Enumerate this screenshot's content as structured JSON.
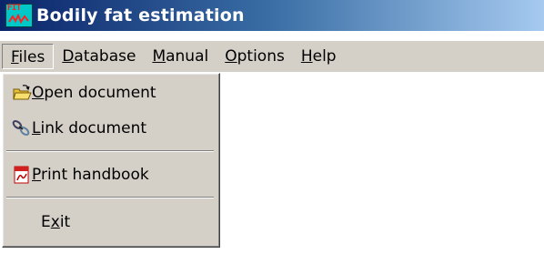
{
  "window": {
    "title": "Bodily fat estimation",
    "icon": "fit-app-icon",
    "icon_text": "FIT"
  },
  "menubar": {
    "items": [
      {
        "label_ul": "F",
        "label_rest": "iles",
        "active": true
      },
      {
        "label_ul": "D",
        "label_rest": "atabase",
        "active": false
      },
      {
        "label_ul": "M",
        "label_rest": "anual",
        "active": false
      },
      {
        "label_ul": "O",
        "label_rest": "ptions",
        "active": false
      },
      {
        "label_ul": "H",
        "label_rest": "elp",
        "active": false
      }
    ]
  },
  "files_menu": {
    "items": [
      {
        "icon": "open-folder-icon",
        "pre": "",
        "ul": "O",
        "rest": "pen document"
      },
      {
        "icon": "link-chain-icon",
        "pre": "",
        "ul": "L",
        "rest": "ink document"
      },
      {
        "icon": "pdf-print-icon",
        "pre": "",
        "ul": "P",
        "rest": "rint handbook"
      },
      {
        "icon": "",
        "pre": "E",
        "ul": "x",
        "rest": "it"
      }
    ]
  },
  "colors": {
    "titlebar_start": "#0a246a",
    "titlebar_end": "#a6caf0",
    "menu_bg": "#d4d0c8"
  }
}
